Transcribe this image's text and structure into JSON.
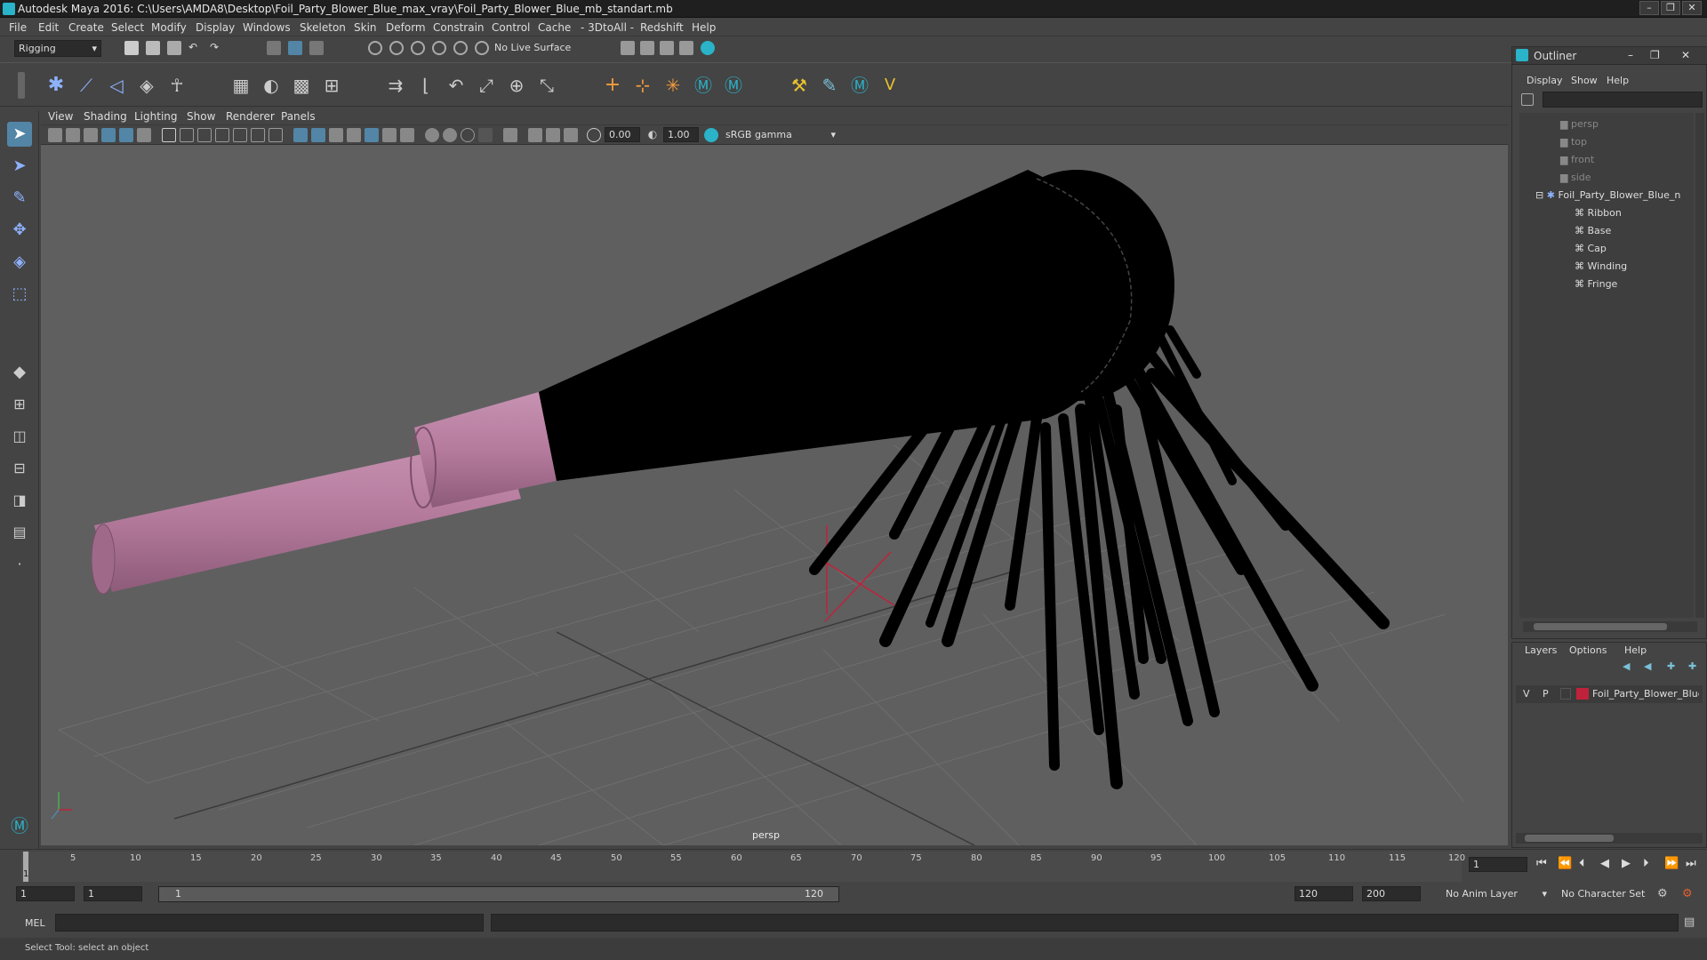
{
  "app": {
    "title": "Autodesk Maya 2016: C:\\Users\\AMDA8\\Desktop\\Foil_Party_Blower_Blue_max_vray\\Foil_Party_Blower_Blue_mb_standart.mb",
    "window_buttons": [
      "–",
      "❐",
      "✕"
    ]
  },
  "menubar": [
    "File",
    "Edit",
    "Create",
    "Select",
    "Modify",
    "Display",
    "Windows",
    "Skeleton",
    "Skin",
    "Deform",
    "Constrain",
    "Control",
    "Cache",
    "- 3DtoAll -",
    "Redshift",
    "Help"
  ],
  "statusline": {
    "mode": "Rigging",
    "live_surface": "No Live Surface"
  },
  "viewport": {
    "menus": [
      "View",
      "Shading",
      "Lighting",
      "Show",
      "Renderer",
      "Panels"
    ],
    "field_a": "0.00",
    "field_b": "1.00",
    "color_space": "sRGB gamma",
    "camera_label": "persp"
  },
  "outliner": {
    "title": "Outliner",
    "menus": [
      "Display",
      "Show",
      "Help"
    ],
    "items": [
      {
        "label": "persp",
        "dim": true
      },
      {
        "label": "top",
        "dim": true
      },
      {
        "label": "front",
        "dim": true
      },
      {
        "label": "side",
        "dim": true
      },
      {
        "label": "Foil_Party_Blower_Blue_n",
        "dim": false
      },
      {
        "label": "Ribbon",
        "dim": false
      },
      {
        "label": "Base",
        "dim": false
      },
      {
        "label": "Cap",
        "dim": false
      },
      {
        "label": "Winding",
        "dim": false
      },
      {
        "label": "Fringe",
        "dim": false
      }
    ]
  },
  "layers": {
    "menus": [
      "Layers",
      "Options",
      "Help"
    ],
    "row": {
      "v": "V",
      "p": "P",
      "name": "Foil_Party_Blower_Blue",
      "color": "#c0223b"
    }
  },
  "timeline": {
    "ticks": [
      "5",
      "10",
      "15",
      "20",
      "25",
      "30",
      "35",
      "40",
      "45",
      "50",
      "55",
      "60",
      "65",
      "70",
      "75",
      "80",
      "85",
      "90",
      "95",
      "100",
      "105",
      "110",
      "115",
      "120"
    ],
    "current_frame": "1",
    "frame_field": "1"
  },
  "range": {
    "start": "1",
    "start2": "1",
    "slider_start": "1",
    "slider_end": "120",
    "end": "120",
    "end2": "200",
    "anim_layer": "No Anim Layer",
    "character_set": "No Character Set"
  },
  "cmdline": {
    "label": "MEL"
  },
  "helpline": {
    "text": "Select Tool: select an object"
  },
  "colors": {
    "accent": "#5285a6",
    "tube": "#b57b9d",
    "cone": "#000000"
  }
}
